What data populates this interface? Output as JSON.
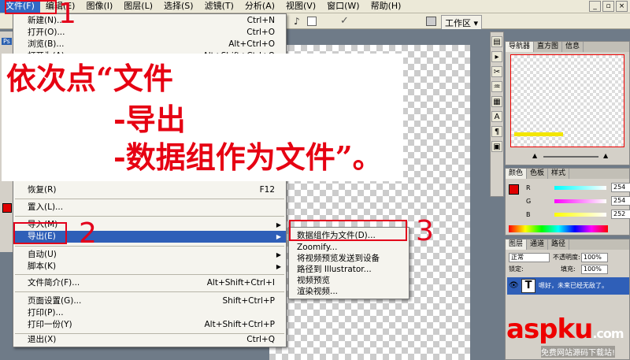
{
  "menubar": {
    "items": [
      "文件(F)",
      "编辑(E)",
      "图像(I)",
      "图层(L)",
      "选择(S)",
      "滤镜(T)",
      "分析(A)",
      "视图(V)",
      "窗口(W)",
      "帮助(H)"
    ]
  },
  "options": {
    "workspace": "工作区 ▾",
    "tool_glyph": "♪"
  },
  "file_menu": {
    "items": [
      {
        "label": "新建(N)...",
        "shortcut": "Ctrl+N"
      },
      {
        "label": "打开(O)...",
        "shortcut": "Ctrl+O"
      },
      {
        "label": "浏览(B)...",
        "shortcut": "Alt+Ctrl+O"
      },
      {
        "label": "打开为(A)...",
        "shortcut": "Alt+Shift+Ctrl+O"
      },
      {
        "label": "恢复(R)",
        "shortcut": "F12"
      },
      {
        "label": "置入(L)...",
        "shortcut": ""
      },
      {
        "label": "导入(M)",
        "shortcut": ""
      },
      {
        "label": "导出(E)",
        "shortcut": ""
      },
      {
        "label": "自动(U)",
        "shortcut": ""
      },
      {
        "label": "脚本(K)",
        "shortcut": ""
      },
      {
        "label": "文件简介(F)...",
        "shortcut": "Alt+Shift+Ctrl+I"
      },
      {
        "label": "页面设置(G)...",
        "shortcut": "Shift+Ctrl+P"
      },
      {
        "label": "打印(P)...",
        "shortcut": ""
      },
      {
        "label": "打印一份(Y)",
        "shortcut": "Alt+Shift+Ctrl+P"
      },
      {
        "label": "退出(X)",
        "shortcut": "Ctrl+Q"
      }
    ]
  },
  "export_submenu": {
    "items": [
      "数据组作为文件(D)...",
      "Zoomify...",
      "将视频预览发送到设备",
      "路径到 Illustrator...",
      "视频预览",
      "渲染视频..."
    ]
  },
  "instructions": {
    "line1": "依次点“文件",
    "line2": "-导出",
    "line3": "-数据组作为文件”。"
  },
  "annotations": {
    "n1": "1",
    "n2": "2",
    "n3": "3"
  },
  "navigator": {
    "tabs": [
      "导航器",
      "直方图",
      "信息"
    ]
  },
  "color_panel": {
    "tabs": [
      "颜色",
      "色板",
      "样式"
    ],
    "r_label": "R",
    "g_label": "G",
    "b_label": "B",
    "r": "254",
    "g": "254",
    "b": "252"
  },
  "layers_panel": {
    "tabs": [
      "图层",
      "通道",
      "路径"
    ],
    "blend_mode": "正常",
    "opacity_label": "不透明度:",
    "opacity": "100%",
    "lock_label": "锁定:",
    "fill_label": "填充:",
    "fill": "100%",
    "layer_name": "嗯好，未来已经无敌了。",
    "layer_thumb": "T"
  },
  "toolbox": {
    "label": "Ps"
  },
  "watermark": {
    "main": "aspku",
    "tld": ".com",
    "sub": "免费网站源码下载站!"
  },
  "colors": {
    "accent": "#e3001b",
    "highlight": "#2f5fb8"
  }
}
